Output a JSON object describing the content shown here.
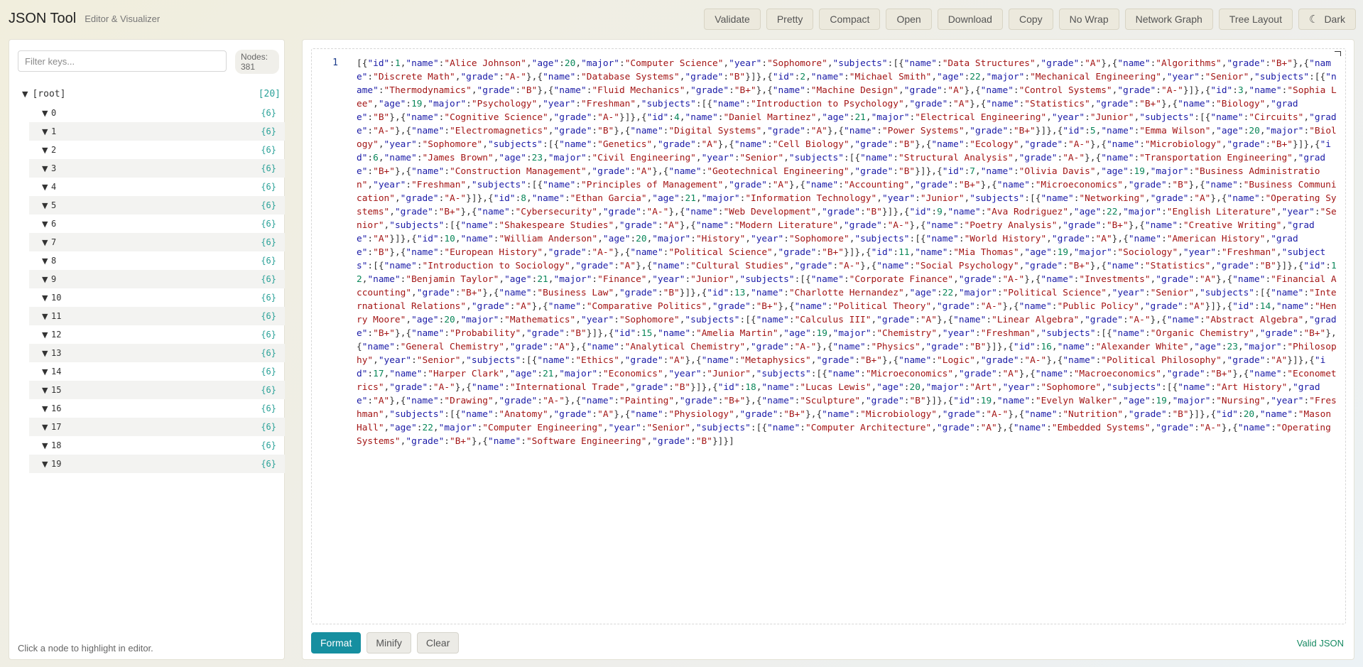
{
  "app": {
    "title": "JSON Tool",
    "subtitle": "Editor & Visualizer"
  },
  "toolbar": [
    {
      "label": "Validate",
      "name": "validate-button"
    },
    {
      "label": "Pretty",
      "name": "pretty-button"
    },
    {
      "label": "Compact",
      "name": "compact-button"
    },
    {
      "label": "Open",
      "name": "open-button"
    },
    {
      "label": "Download",
      "name": "download-button"
    },
    {
      "label": "Copy",
      "name": "copy-button"
    },
    {
      "label": "No Wrap",
      "name": "no-wrap-button"
    },
    {
      "label": "Network Graph",
      "name": "network-graph-button"
    },
    {
      "label": "Tree Layout",
      "name": "tree-layout-button"
    },
    {
      "label": "Dark",
      "name": "dark-mode-button",
      "icon": "moon-icon"
    }
  ],
  "sidebar": {
    "filter_placeholder": "Filter keys...",
    "nodes_label": "Nodes:",
    "nodes_count": "381",
    "root": {
      "label": "[root]",
      "count": "[20]"
    },
    "items": [
      {
        "key": "0",
        "count": "{6}"
      },
      {
        "key": "1",
        "count": "{6}"
      },
      {
        "key": "2",
        "count": "{6}"
      },
      {
        "key": "3",
        "count": "{6}"
      },
      {
        "key": "4",
        "count": "{6}"
      },
      {
        "key": "5",
        "count": "{6}"
      },
      {
        "key": "6",
        "count": "{6}"
      },
      {
        "key": "7",
        "count": "{6}"
      },
      {
        "key": "8",
        "count": "{6}"
      },
      {
        "key": "9",
        "count": "{6}"
      },
      {
        "key": "10",
        "count": "{6}"
      },
      {
        "key": "11",
        "count": "{6}"
      },
      {
        "key": "12",
        "count": "{6}"
      },
      {
        "key": "13",
        "count": "{6}"
      },
      {
        "key": "14",
        "count": "{6}"
      },
      {
        "key": "15",
        "count": "{6}"
      },
      {
        "key": "16",
        "count": "{6}"
      },
      {
        "key": "17",
        "count": "{6}"
      },
      {
        "key": "18",
        "count": "{6}"
      },
      {
        "key": "19",
        "count": "{6}"
      }
    ],
    "hint": "Click a node to highlight in editor."
  },
  "editor": {
    "line_number": "1",
    "content": "[{\"id\":1,\"name\":\"Alice Johnson\",\"age\":20,\"major\":\"Computer Science\",\"year\":\"Sophomore\",\"subjects\":[{\"name\":\"Data Structures\",\"grade\":\"A\"},{\"name\":\"Algorithms\",\"grade\":\"B+\"},{\"name\":\"Discrete Math\",\"grade\":\"A-\"},{\"name\":\"Database Systems\",\"grade\":\"B\"}]},{\"id\":2,\"name\":\"Michael Smith\",\"age\":22,\"major\":\"Mechanical Engineering\",\"year\":\"Senior\",\"subjects\":[{\"name\":\"Thermodynamics\",\"grade\":\"B\"},{\"name\":\"Fluid Mechanics\",\"grade\":\"B+\"},{\"name\":\"Machine Design\",\"grade\":\"A\"},{\"name\":\"Control Systems\",\"grade\":\"A-\"}]},{\"id\":3,\"name\":\"Sophia Lee\",\"age\":19,\"major\":\"Psychology\",\"year\":\"Freshman\",\"subjects\":[{\"name\":\"Introduction to Psychology\",\"grade\":\"A\"},{\"name\":\"Statistics\",\"grade\":\"B+\"},{\"name\":\"Biology\",\"grade\":\"B\"},{\"name\":\"Cognitive Science\",\"grade\":\"A-\"}]},{\"id\":4,\"name\":\"Daniel Martinez\",\"age\":21,\"major\":\"Electrical Engineering\",\"year\":\"Junior\",\"subjects\":[{\"name\":\"Circuits\",\"grade\":\"A-\"},{\"name\":\"Electromagnetics\",\"grade\":\"B\"},{\"name\":\"Digital Systems\",\"grade\":\"A\"},{\"name\":\"Power Systems\",\"grade\":\"B+\"}]},{\"id\":5,\"name\":\"Emma Wilson\",\"age\":20,\"major\":\"Biology\",\"year\":\"Sophomore\",\"subjects\":[{\"name\":\"Genetics\",\"grade\":\"A\"},{\"name\":\"Cell Biology\",\"grade\":\"B\"},{\"name\":\"Ecology\",\"grade\":\"A-\"},{\"name\":\"Microbiology\",\"grade\":\"B+\"}]},{\"id\":6,\"name\":\"James Brown\",\"age\":23,\"major\":\"Civil Engineering\",\"year\":\"Senior\",\"subjects\":[{\"name\":\"Structural Analysis\",\"grade\":\"A-\"},{\"name\":\"Transportation Engineering\",\"grade\":\"B+\"},{\"name\":\"Construction Management\",\"grade\":\"A\"},{\"name\":\"Geotechnical Engineering\",\"grade\":\"B\"}]},{\"id\":7,\"name\":\"Olivia Davis\",\"age\":19,\"major\":\"Business Administration\",\"year\":\"Freshman\",\"subjects\":[{\"name\":\"Principles of Management\",\"grade\":\"A\"},{\"name\":\"Accounting\",\"grade\":\"B+\"},{\"name\":\"Microeconomics\",\"grade\":\"B\"},{\"name\":\"Business Communication\",\"grade\":\"A-\"}]},{\"id\":8,\"name\":\"Ethan Garcia\",\"age\":21,\"major\":\"Information Technology\",\"year\":\"Junior\",\"subjects\":[{\"name\":\"Networking\",\"grade\":\"A\"},{\"name\":\"Operating Systems\",\"grade\":\"B+\"},{\"name\":\"Cybersecurity\",\"grade\":\"A-\"},{\"name\":\"Web Development\",\"grade\":\"B\"}]},{\"id\":9,\"name\":\"Ava Rodriguez\",\"age\":22,\"major\":\"English Literature\",\"year\":\"Senior\",\"subjects\":[{\"name\":\"Shakespeare Studies\",\"grade\":\"A\"},{\"name\":\"Modern Literature\",\"grade\":\"A-\"},{\"name\":\"Poetry Analysis\",\"grade\":\"B+\"},{\"name\":\"Creative Writing\",\"grade\":\"A\"}]},{\"id\":10,\"name\":\"William Anderson\",\"age\":20,\"major\":\"History\",\"year\":\"Sophomore\",\"subjects\":[{\"name\":\"World History\",\"grade\":\"A\"},{\"name\":\"American History\",\"grade\":\"B\"},{\"name\":\"European History\",\"grade\":\"A-\"},{\"name\":\"Political Science\",\"grade\":\"B+\"}]},{\"id\":11,\"name\":\"Mia Thomas\",\"age\":19,\"major\":\"Sociology\",\"year\":\"Freshman\",\"subjects\":[{\"name\":\"Introduction to Sociology\",\"grade\":\"A\"},{\"name\":\"Cultural Studies\",\"grade\":\"A-\"},{\"name\":\"Social Psychology\",\"grade\":\"B+\"},{\"name\":\"Statistics\",\"grade\":\"B\"}]},{\"id\":12,\"name\":\"Benjamin Taylor\",\"age\":21,\"major\":\"Finance\",\"year\":\"Junior\",\"subjects\":[{\"name\":\"Corporate Finance\",\"grade\":\"A-\"},{\"name\":\"Investments\",\"grade\":\"A\"},{\"name\":\"Financial Accounting\",\"grade\":\"B+\"},{\"name\":\"Business Law\",\"grade\":\"B\"}]},{\"id\":13,\"name\":\"Charlotte Hernandez\",\"age\":22,\"major\":\"Political Science\",\"year\":\"Senior\",\"subjects\":[{\"name\":\"International Relations\",\"grade\":\"A\"},{\"name\":\"Comparative Politics\",\"grade\":\"B+\"},{\"name\":\"Political Theory\",\"grade\":\"A-\"},{\"name\":\"Public Policy\",\"grade\":\"A\"}]},{\"id\":14,\"name\":\"Henry Moore\",\"age\":20,\"major\":\"Mathematics\",\"year\":\"Sophomore\",\"subjects\":[{\"name\":\"Calculus III\",\"grade\":\"A\"},{\"name\":\"Linear Algebra\",\"grade\":\"A-\"},{\"name\":\"Abstract Algebra\",\"grade\":\"B+\"},{\"name\":\"Probability\",\"grade\":\"B\"}]},{\"id\":15,\"name\":\"Amelia Martin\",\"age\":19,\"major\":\"Chemistry\",\"year\":\"Freshman\",\"subjects\":[{\"name\":\"Organic Chemistry\",\"grade\":\"B+\"},{\"name\":\"General Chemistry\",\"grade\":\"A\"},{\"name\":\"Analytical Chemistry\",\"grade\":\"A-\"},{\"name\":\"Physics\",\"grade\":\"B\"}]},{\"id\":16,\"name\":\"Alexander White\",\"age\":23,\"major\":\"Philosophy\",\"year\":\"Senior\",\"subjects\":[{\"name\":\"Ethics\",\"grade\":\"A\"},{\"name\":\"Metaphysics\",\"grade\":\"B+\"},{\"name\":\"Logic\",\"grade\":\"A-\"},{\"name\":\"Political Philosophy\",\"grade\":\"A\"}]},{\"id\":17,\"name\":\"Harper Clark\",\"age\":21,\"major\":\"Economics\",\"year\":\"Junior\",\"subjects\":[{\"name\":\"Microeconomics\",\"grade\":\"A\"},{\"name\":\"Macroeconomics\",\"grade\":\"B+\"},{\"name\":\"Econometrics\",\"grade\":\"A-\"},{\"name\":\"International Trade\",\"grade\":\"B\"}]},{\"id\":18,\"name\":\"Lucas Lewis\",\"age\":20,\"major\":\"Art\",\"year\":\"Sophomore\",\"subjects\":[{\"name\":\"Art History\",\"grade\":\"A\"},{\"name\":\"Drawing\",\"grade\":\"A-\"},{\"name\":\"Painting\",\"grade\":\"B+\"},{\"name\":\"Sculpture\",\"grade\":\"B\"}]},{\"id\":19,\"name\":\"Evelyn Walker\",\"age\":19,\"major\":\"Nursing\",\"year\":\"Freshman\",\"subjects\":[{\"name\":\"Anatomy\",\"grade\":\"A\"},{\"name\":\"Physiology\",\"grade\":\"B+\"},{\"name\":\"Microbiology\",\"grade\":\"A-\"},{\"name\":\"Nutrition\",\"grade\":\"B\"}]},{\"id\":20,\"name\":\"Mason Hall\",\"age\":22,\"major\":\"Computer Engineering\",\"year\":\"Senior\",\"subjects\":[{\"name\":\"Computer Architecture\",\"grade\":\"A\"},{\"name\":\"Embedded Systems\",\"grade\":\"A-\"},{\"name\":\"Operating Systems\",\"grade\":\"B+\"},{\"name\":\"Software Engineering\",\"grade\":\"B\"}]}]"
  },
  "bottom_bar": {
    "format_label": "Format",
    "minify_label": "Minify",
    "clear_label": "Clear",
    "status": "Valid JSON"
  },
  "colors": {
    "accent": "#168fa0",
    "json_key": "#1a1aa6",
    "json_string": "#a31515",
    "json_number": "#098658",
    "tree_count": "#2aa198",
    "valid": "#168a62"
  }
}
